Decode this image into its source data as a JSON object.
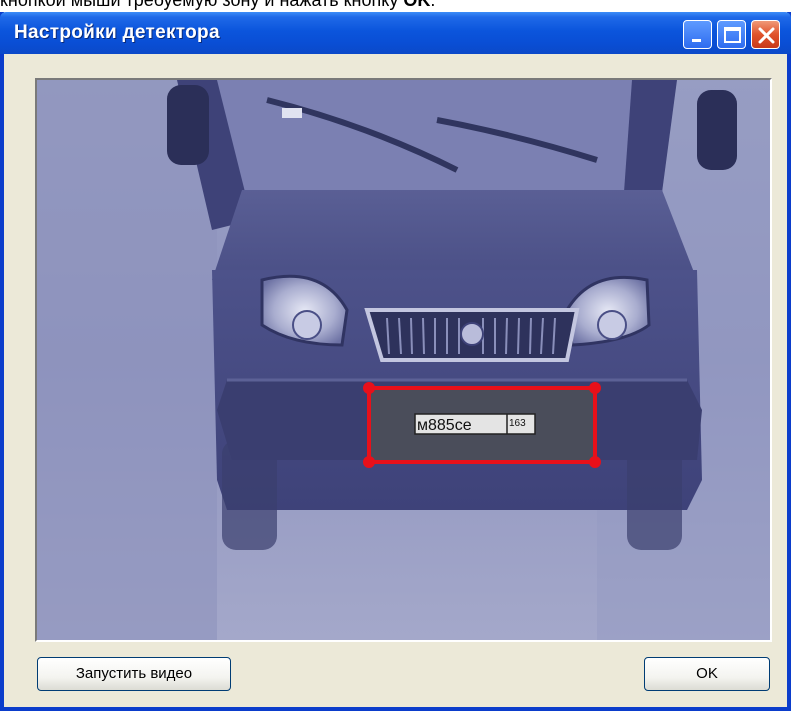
{
  "instruction": {
    "text_normal": "кнопкой мыши требуемую зону и нажать кнопку ",
    "text_bold": "OK",
    "text_end": "."
  },
  "window": {
    "title": "Настройки детектора"
  },
  "video": {
    "plate_number": "м885се",
    "plate_region": "163"
  },
  "buttons": {
    "start_video": "Запустить видео",
    "ok": "OK"
  },
  "colors": {
    "titlebar": "#0b55dc",
    "selection": "#e8101a",
    "video_tint": "#6f74b0",
    "window_bg": "#ece9d8"
  }
}
